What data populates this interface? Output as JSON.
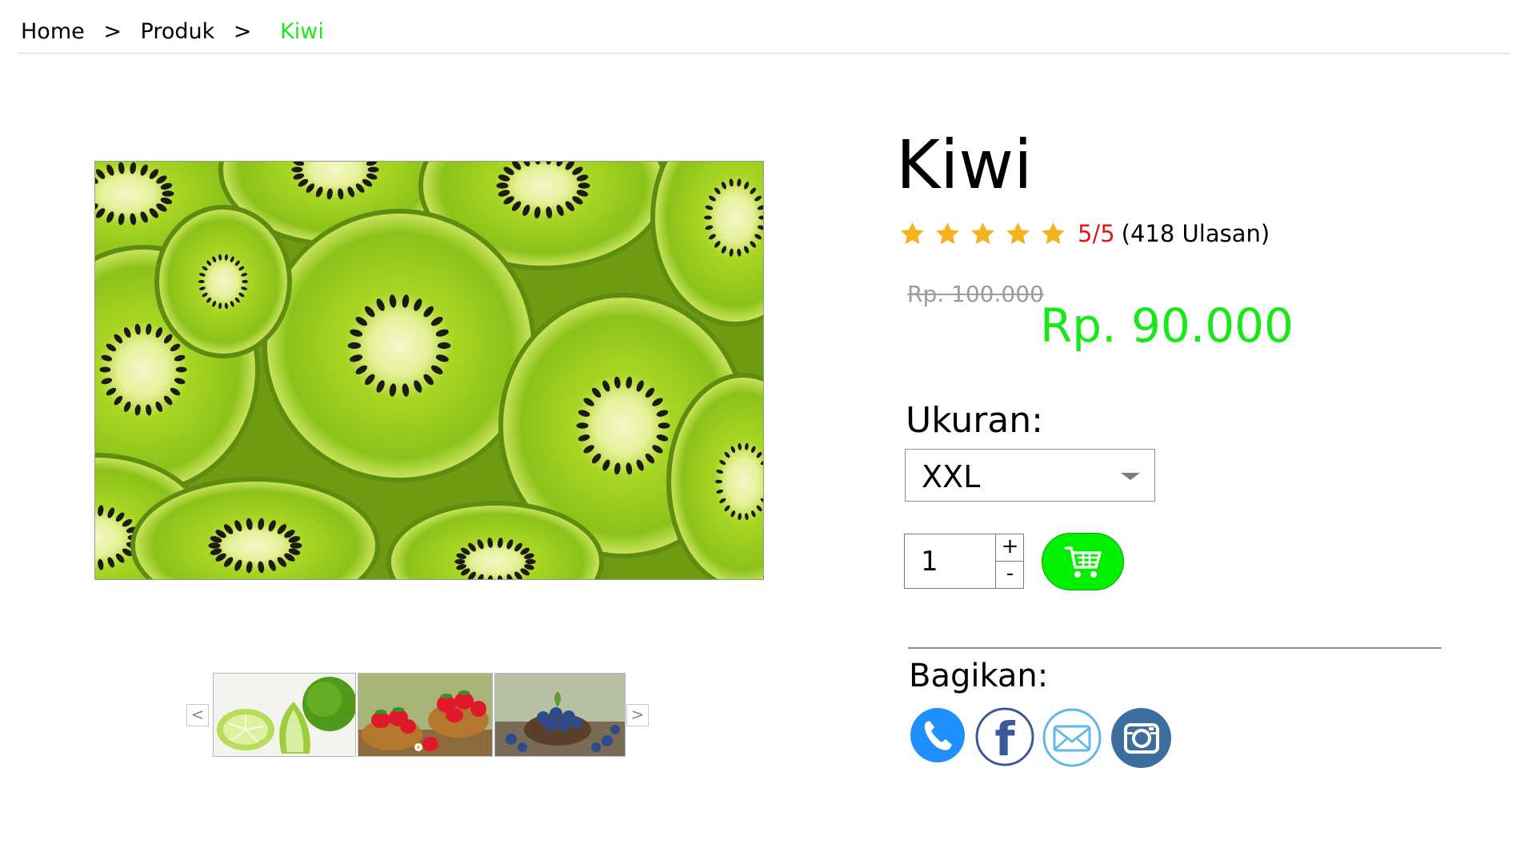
{
  "breadcrumb": {
    "items": [
      "Home",
      "Produk"
    ],
    "separator": ">",
    "current": "Kiwi"
  },
  "colors": {
    "accent_green": "#18e818",
    "rating_red": "#e01818",
    "star_yellow": "#f6b21c",
    "cart_button": "#00f000"
  },
  "gallery": {
    "main_image": "kiwi-slices",
    "thumbnails": [
      "lime",
      "strawberries",
      "blueberries"
    ],
    "prev_arrow": "<",
    "next_arrow": ">"
  },
  "product": {
    "name": "Kiwi",
    "rating": {
      "stars": 5,
      "max_stars": 5,
      "score": "5/5",
      "reviews": "(418 Ulasan)"
    },
    "old_price": "Rp. 100.000",
    "price": "Rp. 90.000",
    "size_label": "Ukuran:",
    "size_value": "XXL",
    "quantity": "1",
    "plus": "+",
    "minus": "-"
  },
  "share": {
    "label": "Bagikan:",
    "icons": [
      "phone-icon",
      "facebook-icon",
      "email-icon",
      "instagram-icon"
    ]
  }
}
